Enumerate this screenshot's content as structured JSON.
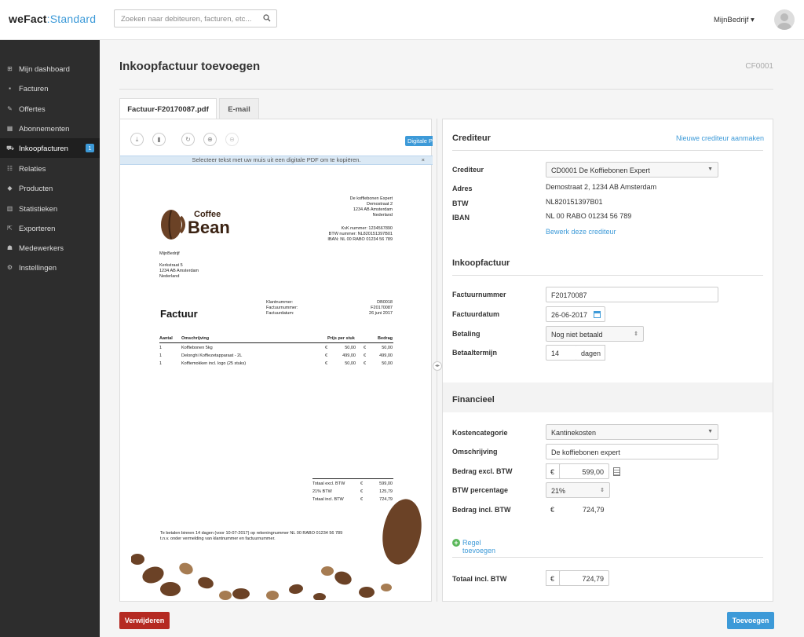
{
  "header": {
    "logo_we": "weFact",
    "logo_colon": ":",
    "logo_std": "Standard",
    "search_placeholder": "Zoeken naar debiteuren, facturen, etc...",
    "user": "MijnBedrijf ▾"
  },
  "sidebar": {
    "items": [
      {
        "label": "Mijn dashboard",
        "icon": "dashboard-icon"
      },
      {
        "label": "Facturen",
        "icon": "document-icon"
      },
      {
        "label": "Offertes",
        "icon": "pencil-icon"
      },
      {
        "label": "Abonnementen",
        "icon": "calendar-icon"
      },
      {
        "label": "Inkoopfacturen",
        "icon": "cart-icon",
        "badge": "1"
      },
      {
        "label": "Relaties",
        "icon": "users-icon"
      },
      {
        "label": "Producten",
        "icon": "tag-icon"
      },
      {
        "label": "Statistieken",
        "icon": "chart-icon"
      },
      {
        "label": "Exporteren",
        "icon": "export-icon"
      },
      {
        "label": "Medewerkers",
        "icon": "people-icon"
      },
      {
        "label": "Instellingen",
        "icon": "gear-icon"
      }
    ]
  },
  "page": {
    "title": "Inkoopfactuur toevoegen",
    "code": "CF0001"
  },
  "tabs": [
    "Factuur-F20170087.pdf",
    "E-mail"
  ],
  "pdf": {
    "digital_btn": "Digitale PDF",
    "info": "Selecteer tekst met uw muis uit een digitale PDF om te kopiëren.",
    "close": "×",
    "logo_coffee": "Coffee",
    "logo_bean": "Bean",
    "sender": [
      "De koffiebonen Expert",
      "Demostraat 2",
      "1234 AB Amsterdam",
      "Nederland"
    ],
    "sender_ids": [
      "KvK nummer: 1234567890",
      "BTW nummer: NL820151397B01",
      "IBAN: NL 00 RABO 01234 56 789"
    ],
    "recipient": [
      "MijnBedrijf",
      "",
      "Kerkstraat 5",
      "1234 AB Amsterdam",
      "Nederland"
    ],
    "doc_title": "Factuur",
    "meta_labels": [
      "Klantnummer:",
      "Factuurnummer:",
      "Factuurdatum:"
    ],
    "meta_values": [
      "DB0018",
      "F20170087",
      "26 juni 2017"
    ],
    "col_headers": [
      "Aantal",
      "Omschrijving",
      "Prijs per stuk",
      "Bedrag"
    ],
    "rows": [
      {
        "qty": "1",
        "desc": "Koffiebonen 5kg",
        "cur1": "€",
        "price": "50,00",
        "cur2": "€",
        "amount": "50,00"
      },
      {
        "qty": "1",
        "desc": "Delonghi Koffiezetapparaat - 2L",
        "cur1": "€",
        "price": "499,00",
        "cur2": "€",
        "amount": "499,00"
      },
      {
        "qty": "1",
        "desc": "Koffiemokken incl. logo (25 stuks)",
        "cur1": "€",
        "price": "50,00",
        "cur2": "€",
        "amount": "50,00"
      }
    ],
    "totals": [
      {
        "label": "Totaal excl. BTW",
        "cur": "€",
        "value": "599,00"
      },
      {
        "label": "21% BTW",
        "cur": "€",
        "value": "125,79"
      },
      {
        "label": "Totaal incl. BTW",
        "cur": "€",
        "value": "724,79"
      }
    ],
    "footer1": "Te betalen binnen 14 dagen (voor 10-07-2017) op rekeningnummer NL 00 RABO 01234 56 789",
    "footer2": "t.n.v. onder vermelding van klantnummer en factuurnummer."
  },
  "crediteur": {
    "title": "Crediteur",
    "new_link": "Nieuwe crediteur aanmaken",
    "label_crediteur": "Crediteur",
    "value_crediteur": "CD0001 De Koffiebonen Expert",
    "label_adres": "Adres",
    "value_adres": "Demostraat 2, 1234 AB Amsterdam",
    "label_btw": "BTW",
    "value_btw": "NL820151397B01",
    "label_iban": "IBAN",
    "value_iban": "NL 00 RABO 01234 56 789",
    "edit_link": "Bewerk deze crediteur"
  },
  "inkoop": {
    "title": "Inkoopfactuur",
    "label_nummer": "Factuurnummer",
    "value_nummer": "F20170087",
    "label_datum": "Factuurdatum",
    "value_datum": "26-06-2017",
    "label_betaling": "Betaling",
    "value_betaling": "Nog niet betaald",
    "label_termijn": "Betaaltermijn",
    "value_termijn": "14",
    "unit_termijn": "dagen"
  },
  "financieel": {
    "title": "Financieel",
    "label_kosten": "Kostencategorie",
    "value_kosten": "Kantinekosten",
    "label_omschr": "Omschrijving",
    "value_omschr": "De koffiebonen expert",
    "label_excl": "Bedrag excl. BTW",
    "cur": "€",
    "value_excl": "599,00",
    "label_perc": "BTW percentage",
    "value_perc": "21%",
    "label_incl": "Bedrag incl. BTW",
    "value_incl": "724,79",
    "add_line": "Regel toevoegen",
    "label_total": "Totaal incl. BTW",
    "value_total": "724,79"
  },
  "buttons": {
    "delete": "Verwijderen",
    "add": "Toevoegen"
  },
  "colors": {
    "accent": "#3d9ad8",
    "danger": "#b52a22",
    "sidebar": "#2d2d2d",
    "coffee": "#6b4226"
  }
}
